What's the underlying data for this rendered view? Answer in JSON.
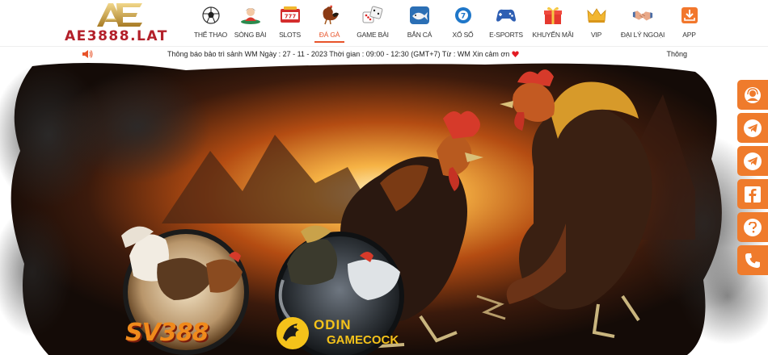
{
  "brand": {
    "name": "AE3888.LAT",
    "logo_letters": "AE"
  },
  "nav": [
    {
      "label": "THỂ THAO",
      "icon": "soccer-ball-icon"
    },
    {
      "label": "SÒNG BÀI",
      "icon": "dealer-icon"
    },
    {
      "label": "SLOTS",
      "icon": "slot-machine-icon"
    },
    {
      "label": "ĐÁ GÀ",
      "icon": "rooster-icon",
      "active": true
    },
    {
      "label": "GAME BÀI",
      "icon": "dice-icon"
    },
    {
      "label": "BẮN CÁ",
      "icon": "fish-icon"
    },
    {
      "label": "XỔ SỐ",
      "icon": "lottery-ball-icon"
    },
    {
      "label": "E-SPORTS",
      "icon": "gamepad-icon"
    },
    {
      "label": "KHUYẾN MÃI",
      "icon": "gift-icon"
    },
    {
      "label": "VIP",
      "icon": "crown-icon"
    },
    {
      "label": "ĐẠI LÝ NGOẠI",
      "icon": "handshake-icon"
    },
    {
      "label": "APP",
      "icon": "download-icon"
    }
  ],
  "notice": {
    "text": "Thông báo bảo trì sảnh WM Ngày : 27 - 11 - 2023 Thời gian : 09:00 - 12:30 (GMT+7) Từ : WM Xin cảm ơn",
    "right_label": "Thông"
  },
  "banner": {
    "logo_left": "SV388",
    "logo_right_line1": "ODIN",
    "logo_right_line2": "GAMECOCK"
  },
  "floatbar": [
    "support-icon",
    "telegram-icon",
    "telegram-icon",
    "facebook-icon",
    "question-icon",
    "phone-icon"
  ],
  "colors": {
    "accent": "#e8542a",
    "float": "#ef7b2c",
    "brand": "#b3202a",
    "gold": "#c9a24a"
  }
}
